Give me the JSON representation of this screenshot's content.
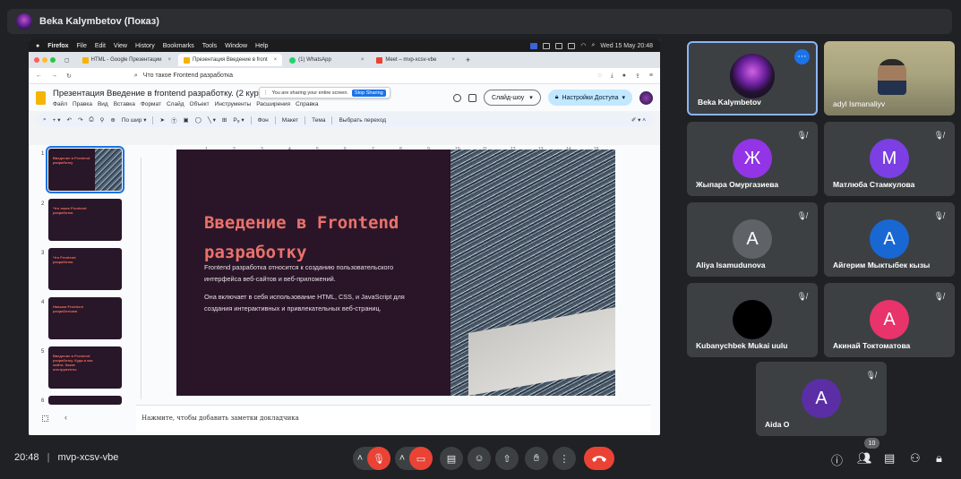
{
  "meet": {
    "presenter_title": "Beka Kalymbetov (Показ)",
    "time": "20:48",
    "meeting_code": "mvp-xcsv-vbe",
    "people_count": "10"
  },
  "mac_menubar": {
    "app": "Firefox",
    "items": [
      "File",
      "Edit",
      "View",
      "History",
      "Bookmarks",
      "Tools",
      "Window",
      "Help"
    ],
    "clock": "Wed 15 May 20:48"
  },
  "browser": {
    "tabs": [
      {
        "label": "HTML - Google Презентации",
        "color": "#f4b400"
      },
      {
        "label": "Презентация Введение в front",
        "color": "#f4b400"
      },
      {
        "label": "(1) WhatsApp",
        "color": "#25d366"
      },
      {
        "label": "Meet – mvp-xcsv-vbe",
        "color": "#ea4335"
      }
    ],
    "url": "Что такое Frontend разработка"
  },
  "docs": {
    "title": "Презентация Введение в frontend разработку. (2 курс)",
    "menu": [
      "Файл",
      "Правка",
      "Вид",
      "Вставка",
      "Формат",
      "Слайд",
      "Объект",
      "Инструменты",
      "Расширения",
      "Справка"
    ],
    "sharing_text": "You are sharing your entire screen.",
    "stop_sharing": "Stop Sharing",
    "slideshow": "Слайд-шоу",
    "access": "Настройки Доступа",
    "toolbar": {
      "zoom": "По шир",
      "background": "Фон",
      "layout": "Макет",
      "theme": "Тема",
      "transition": "Выбрать переход"
    },
    "notes_placeholder": "Нажмите, чтобы добавить заметки докладчика"
  },
  "ruler_ticks": [
    "1",
    "2",
    "3",
    "4",
    "5",
    "6",
    "7",
    "8",
    "9",
    "10",
    "11",
    "12",
    "13",
    "14",
    "15"
  ],
  "thumbnails": [
    {
      "num": "1",
      "title": "Введение в Frontend разработку"
    },
    {
      "num": "2",
      "title": "Что такое Frontend разработка"
    },
    {
      "num": "3",
      "title": "Что Frontend разработка"
    },
    {
      "num": "4",
      "title": "Навыки Frontend разработчика"
    },
    {
      "num": "5",
      "title": "Введение в Frontend разработку. Куда и как найти. Какие инструменты"
    },
    {
      "num": "6",
      "title": ""
    }
  ],
  "slide": {
    "title": "Введение в Frontend разработку",
    "p1": "Frontend разработка относится к созданию пользовательского интерфейса веб-сайтов и веб-приложений.",
    "p2": "Она включает в себя использование HTML, CSS, и JavaScript для создания интерактивных и привлекательных веб-страниц."
  },
  "participants": [
    {
      "name": "Beka Kalymbetov",
      "initial": "",
      "color": ""
    },
    {
      "name": "adyl Ismanaliyv",
      "initial": "",
      "color": ""
    },
    {
      "name": "Жыпара Омургазиева",
      "initial": "Ж",
      "color": "#9334e6"
    },
    {
      "name": "Матлюба Стамкулова",
      "initial": "М",
      "color": "#7b3fe4"
    },
    {
      "name": "Aliya Isamudunova",
      "initial": "A",
      "color": "#5f6368"
    },
    {
      "name": "Айгерим Мыктыбек кызы",
      "initial": "A",
      "color": "#1967d2"
    },
    {
      "name": "Kubanychbek Mukai uulu",
      "initial": "",
      "color": "#000000"
    },
    {
      "name": "Акинай Токтоматова",
      "initial": "A",
      "color": "#e8336b"
    },
    {
      "name": "Aida O",
      "initial": "A",
      "color": "#5b2ea6"
    }
  ]
}
